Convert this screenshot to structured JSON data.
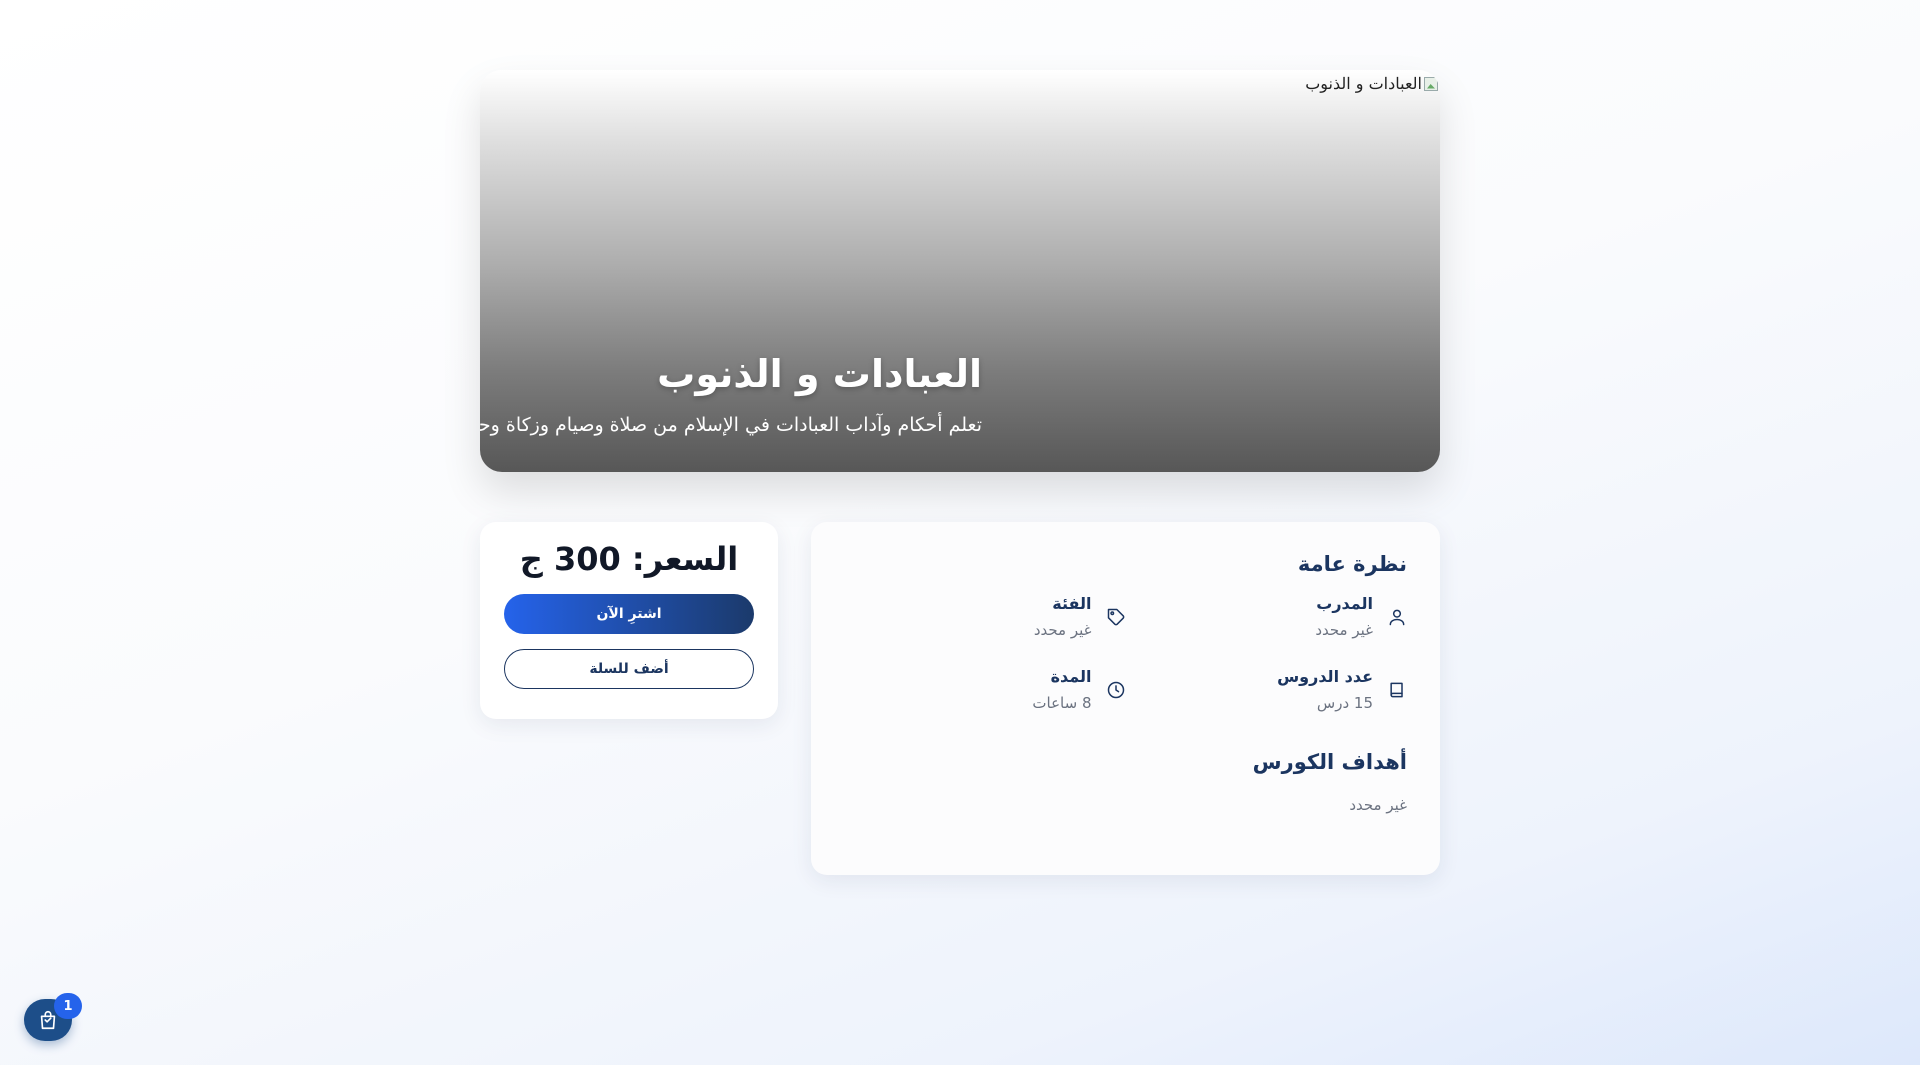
{
  "hero": {
    "image_alt": "العبادات و الذنوب",
    "title": "العبادات و الذنوب",
    "subtitle": "تعلم أحكام وآداب العبادات في الإسلام من صلاة وصيام وزكاة وحج"
  },
  "overview": {
    "title": "نظرة عامة",
    "items": [
      {
        "label": "المدرب",
        "value": "غير محدد",
        "icon": "user-icon"
      },
      {
        "label": "الفئة",
        "value": "غير محدد",
        "icon": "tag-icon"
      },
      {
        "label": "عدد الدروس",
        "value": "15 درس",
        "icon": "book-icon"
      },
      {
        "label": "المدة",
        "value": "8 ساعات",
        "icon": "clock-icon"
      }
    ],
    "goals_title": "أهداف الكورس",
    "goals_value": "غير محدد"
  },
  "pricing": {
    "price": "السعر: 300 ج",
    "buy_label": "اشترِ الآن",
    "cart_label": "أضف للسلة"
  },
  "cart": {
    "count": "1",
    "icon": "shopping-bag-icon"
  },
  "colors": {
    "primary": "#1b3560",
    "accent": "#2563eb",
    "muted": "#6b7280"
  }
}
